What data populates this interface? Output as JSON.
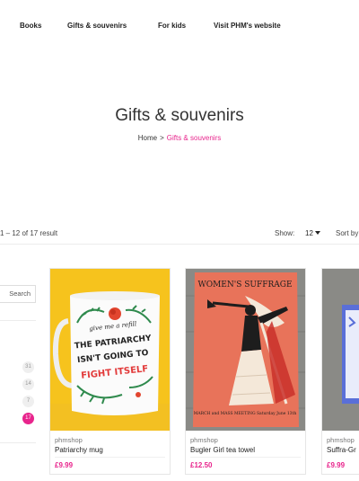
{
  "nav": {
    "items": [
      "Books",
      "Gifts & souvenirs",
      "For kids",
      "Visit PHM's website"
    ]
  },
  "hero": {
    "title": "Gifts & souvenirs",
    "breadcrumb_home": "Home",
    "breadcrumb_sep": ">",
    "breadcrumb_current": "Gifts & souvenirs"
  },
  "toolbar": {
    "result_count": "1 – 12 of 17 result",
    "show_label": "Show:",
    "show_value": "12",
    "sort_label": "Sort by"
  },
  "sidebar": {
    "search_label": "Search",
    "page_counts": [
      "31",
      "14",
      "7",
      "17"
    ]
  },
  "products": [
    {
      "vendor": "phmshop",
      "name": "Patriarchy mug",
      "price": "£9.99"
    },
    {
      "vendor": "phmshop",
      "name": "Bugler Girl tea towel",
      "price": "£12.50"
    },
    {
      "vendor": "phmshop",
      "name": "Suffra-Gr",
      "price": "£9.99"
    }
  ],
  "artwork": {
    "mug_lines": [
      "give me a refill",
      "THE PATRIARCHY",
      "ISN'T GOING TO",
      "FIGHT ITSELF"
    ],
    "towel_title": "WOMEN'S SUFFRAGE",
    "towel_footer": "MARCH and MASS MEETING Saturday June 13th"
  },
  "colors": {
    "accent": "#e8248c",
    "mug_background": "#f6c31d",
    "towel_background": "#e8735a",
    "wood": "#8a8a86"
  }
}
